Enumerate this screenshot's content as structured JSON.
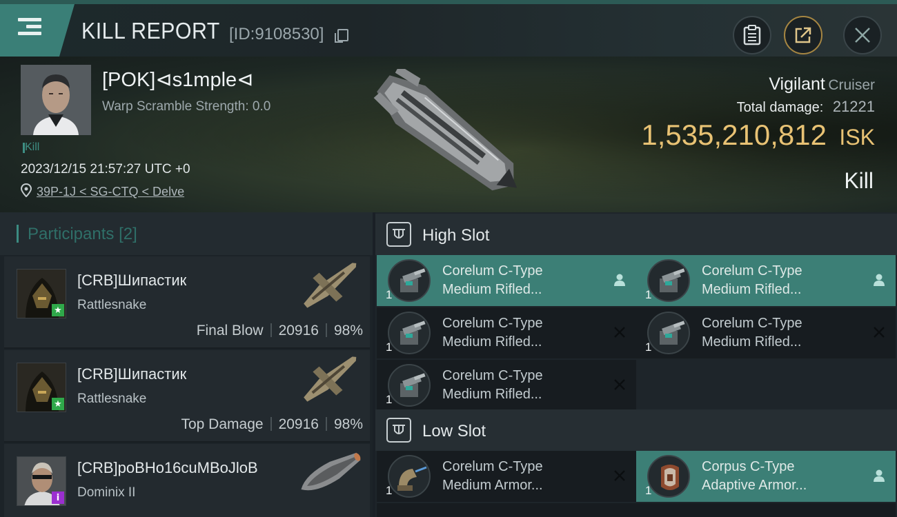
{
  "header": {
    "title": "KILL REPORT",
    "report_id": "[ID:9108530]"
  },
  "victim": {
    "name": "[POK]⊲s1mple⊲",
    "warp_scramble": "Warp Scramble Strength: 0.0",
    "kill_tag": "Kill",
    "timestamp": "2023/12/15 21:57:27 UTC +0",
    "location": "39P-1J < SG-CTQ < Delve",
    "ship_name": "Vigilant",
    "ship_class": "Cruiser",
    "total_damage_label": "Total damage:",
    "total_damage": "21221",
    "isk_value": "1,535,210,812",
    "isk_unit": "ISK",
    "result": "Kill"
  },
  "participants": {
    "label": "Participants",
    "count": "[2]",
    "rows": [
      {
        "name": "[CRB]Шипастик",
        "ship": "Rattlesnake",
        "role": "Final Blow",
        "damage": "20916",
        "percent": "98%",
        "badge": "★",
        "badge_color": "#2fa84a"
      },
      {
        "name": "[CRB]Шипастик",
        "ship": "Rattlesnake",
        "role": "Top Damage",
        "damage": "20916",
        "percent": "98%",
        "badge": "★",
        "badge_color": "#2fa84a"
      },
      {
        "name": "[CRB]poBHo16cuMBoJloB",
        "ship": "Dominix II",
        "role": "",
        "damage": "",
        "percent": "",
        "badge": "i",
        "badge_color": "#9b2fd0"
      }
    ]
  },
  "fitting": {
    "high_slot_label": "High Slot",
    "low_slot_label": "Low Slot",
    "high_slots": [
      {
        "qty": "1",
        "line1": "Corelum C-Type",
        "line2": "Medium Rifled...",
        "status": "dropped"
      },
      {
        "qty": "1",
        "line1": "Corelum C-Type",
        "line2": "Medium Rifled...",
        "status": "dropped"
      },
      {
        "qty": "1",
        "line1": "Corelum C-Type",
        "line2": "Medium Rifled...",
        "status": "destroyed"
      },
      {
        "qty": "1",
        "line1": "Corelum C-Type",
        "line2": "Medium Rifled...",
        "status": "destroyed"
      },
      {
        "qty": "1",
        "line1": "Corelum C-Type",
        "line2": "Medium Rifled...",
        "status": "destroyed"
      }
    ],
    "low_slots": [
      {
        "qty": "1",
        "line1": "Corelum C-Type",
        "line2": "Medium Armor...",
        "status": "destroyed"
      },
      {
        "qty": "1",
        "line1": "Corpus C-Type",
        "line2": "Adaptive Armor...",
        "status": "dropped"
      }
    ]
  },
  "colors": {
    "accent_teal": "#3c7f76",
    "isk_gold": "#e8c274",
    "share_ring": "#a68642"
  },
  "icons": [
    "menu-icon",
    "copy-icon",
    "clipboard-icon",
    "share-icon",
    "close-icon",
    "location-pin-icon",
    "slot-icon",
    "drop-person-icon",
    "destroyed-x-icon"
  ]
}
